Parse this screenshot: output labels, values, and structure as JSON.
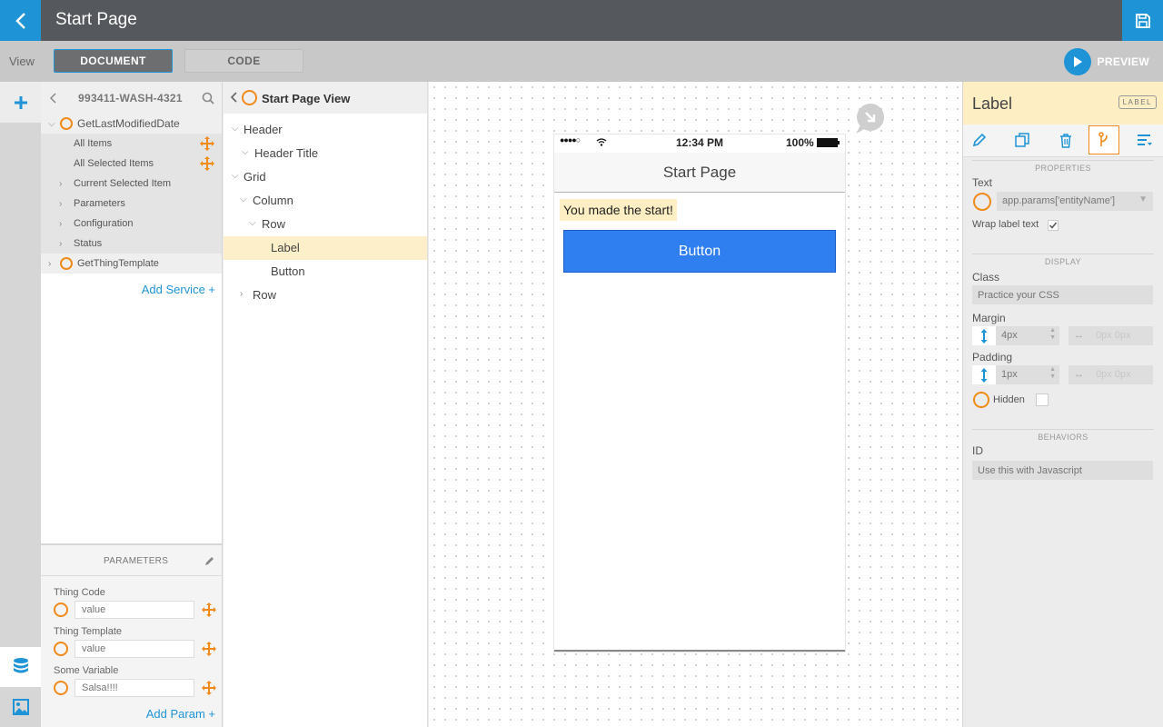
{
  "topbar": {
    "title": "Start Page"
  },
  "viewbar": {
    "view_label": "View",
    "tab_document": "DOCUMENT",
    "tab_code": "CODE",
    "preview_label": "PREVIEW"
  },
  "services": {
    "title": "993411-WASH-4321",
    "items": [
      {
        "label": "GetLastModifiedDate"
      },
      {
        "label": "All Items"
      },
      {
        "label": "All Selected Items"
      },
      {
        "label": "Current Selected Item"
      },
      {
        "label": "Parameters"
      },
      {
        "label": "Configuration"
      },
      {
        "label": "Status"
      },
      {
        "label": "GetThingTemplate"
      }
    ],
    "add_service": "Add Service +"
  },
  "params": {
    "title": "PARAMETERS",
    "items": [
      {
        "label": "Thing Code",
        "placeholder": "value"
      },
      {
        "label": "Thing Template",
        "placeholder": "value"
      },
      {
        "label": "Some Variable",
        "placeholder": "Salsa!!!!"
      }
    ],
    "add_param": "Add Param +"
  },
  "tree": {
    "title": "Start Page View",
    "nodes": [
      {
        "label": "Header"
      },
      {
        "label": "Header Title"
      },
      {
        "label": "Grid"
      },
      {
        "label": "Column"
      },
      {
        "label": "Row"
      },
      {
        "label": "Label"
      },
      {
        "label": "Button"
      },
      {
        "label": "Row"
      }
    ]
  },
  "phone": {
    "time": "12:34 PM",
    "battery": "100%",
    "header_title": "Start Page",
    "label_text": "You made the start!",
    "button_text": "Button"
  },
  "props": {
    "title": "Label",
    "badge": "LABEL",
    "section_properties": "PROPERTIES",
    "text_label": "Text",
    "text_value": "app.params['entityName']",
    "wrap_label": "Wrap label text",
    "section_display": "DISPLAY",
    "class_label": "Class",
    "class_placeholder": "Practice your CSS",
    "margin_label": "Margin",
    "margin_value": "4px",
    "margin_h": "0px 0px",
    "padding_label": "Padding",
    "padding_value": "1px",
    "padding_h": "0px 0px",
    "hidden_label": "Hidden",
    "section_behaviors": "BEHAVIORS",
    "id_label": "ID",
    "id_placeholder": "Use this with Javascript"
  },
  "colors": {
    "accent": "#1e94d7",
    "orange": "#f08a1b",
    "selection": "#fdefc9",
    "button": "#2f7ff0"
  }
}
